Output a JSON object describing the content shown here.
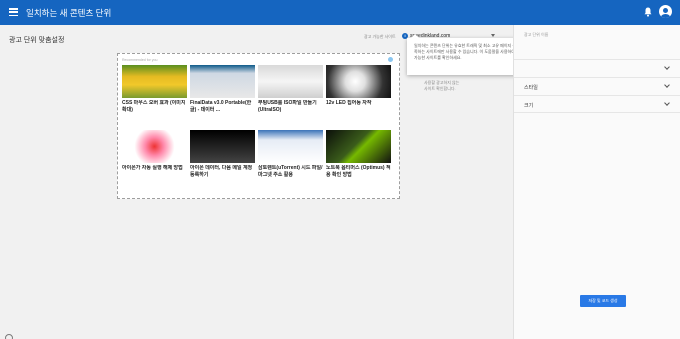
{
  "header": {
    "title": "일치하는 새 콘텐츠 단위",
    "menu_icon": "menu-icon",
    "bell_icon": "notification-bell-icon",
    "avatar_icon": "account-avatar-icon",
    "bar_color": "#1565c0"
  },
  "page": {
    "title": "광고 단위 맞춤설정"
  },
  "site_select": {
    "label": "광고 가능한 사이트",
    "value": "speedinkland.com"
  },
  "tooltip": {
    "lines": [
      "일치하는 콘텐츠 단위는 유효한 트래픽 및 최소 고유 페이지 수를 충",
      "족하는 사이트에만 사용할 수 있습니다. 이 도움말을 사용하여 광고",
      "가능한 사이트를 확인하세요."
    ]
  },
  "hidden_text": {
    "line1": "사용할 광고 단위 유형을",
    "line2": "자료 및 중요한 정보",
    "line3": "사용할 광고하지 않는",
    "line4": "사이트 확인합니다."
  },
  "preview": {
    "ad_label": "Recommended for you",
    "cards": [
      {
        "caption": "CSS 마우스 오버 효과 (이미지 확대)"
      },
      {
        "caption": "FinalData v3.0 Portable(한글) - 데이터 ..."
      },
      {
        "caption": "부팅USB를 ISO파일 만들기 (UltraISO)"
      },
      {
        "caption": "12v LED 집어등 자작"
      },
      {
        "caption": "아이폰가 자동 실행 해제 방법"
      },
      {
        "caption": "아이폰 데이터, 다음 메일 계정 등록하기"
      },
      {
        "caption": "삼토렌트(uTorrent) 시드 파일/마그넷 주소 활용"
      },
      {
        "caption": "노트북 옵티머스 (Optimus) 적용 확인 방법"
      }
    ]
  },
  "panel": {
    "name_label": "광고 단위 이름",
    "rows": [
      {
        "label": ""
      },
      {
        "label": "스타일"
      },
      {
        "label": "크기"
      }
    ],
    "save_button": "저장 및 코드 생성",
    "button_color": "#2979e6"
  }
}
